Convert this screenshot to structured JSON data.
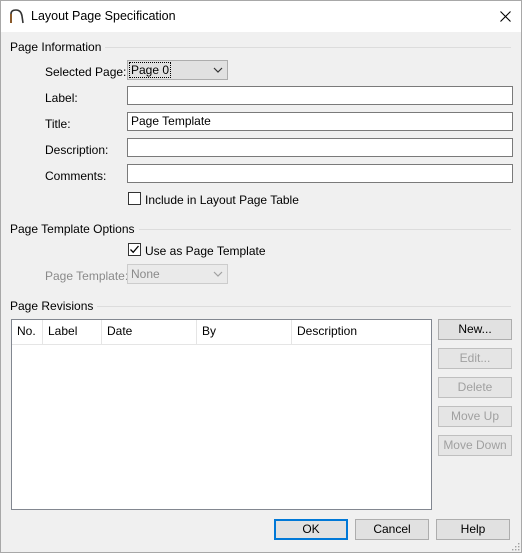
{
  "window": {
    "title": "Layout Page Specification",
    "app_icon": "arch-icon",
    "close_icon": "close-icon"
  },
  "page_information": {
    "heading": "Page Information",
    "selected_page_label": "Selected Page:",
    "selected_page_value": "Page 0",
    "label_label": "Label:",
    "label_value": "",
    "title_label": "Title:",
    "title_value": "Page Template",
    "description_label": "Description:",
    "description_value": "",
    "comments_label": "Comments:",
    "comments_value": "",
    "include_label": "Include in Layout Page Table",
    "include_checked": false
  },
  "page_template_options": {
    "heading": "Page Template Options",
    "use_as_template_label": "Use as Page Template",
    "use_as_template_checked": true,
    "page_template_label": "Page Template:",
    "page_template_value": "None"
  },
  "page_revisions": {
    "heading": "Page Revisions",
    "columns": [
      "No.",
      "Label",
      "Date",
      "By",
      "Description"
    ],
    "rows": [],
    "buttons": {
      "new": "New...",
      "edit": "Edit...",
      "delete": "Delete",
      "move_up": "Move Up",
      "move_down": "Move Down"
    }
  },
  "footer": {
    "ok": "OK",
    "cancel": "Cancel",
    "help": "Help"
  },
  "colors": {
    "accent": "#0078d7",
    "dialog_bg": "#f0f0f0",
    "disabled_text": "#8a8a8a"
  }
}
